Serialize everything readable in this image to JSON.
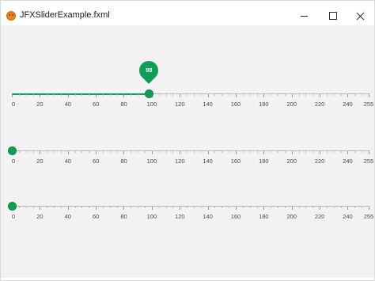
{
  "window": {
    "title": "JFXSliderExample.fxml",
    "app_icon": "java-duke-icon",
    "controls": {
      "minimize": "minimize-icon",
      "maximize": "maximize-icon",
      "close": "close-icon"
    }
  },
  "accent_color": "#0f9d58",
  "sliders": [
    {
      "value": 98,
      "value_label": "98",
      "min": 0,
      "max": 255,
      "show_value_indicator": true
    },
    {
      "value": 0,
      "min": 0,
      "max": 255,
      "show_value_indicator": false
    },
    {
      "value": 0,
      "min": 0,
      "max": 255,
      "show_value_indicator": false
    }
  ],
  "tick_labels": [
    "0",
    "20",
    "40",
    "60",
    "80",
    "100",
    "120",
    "140",
    "160",
    "180",
    "200",
    "220",
    "240",
    "255"
  ]
}
